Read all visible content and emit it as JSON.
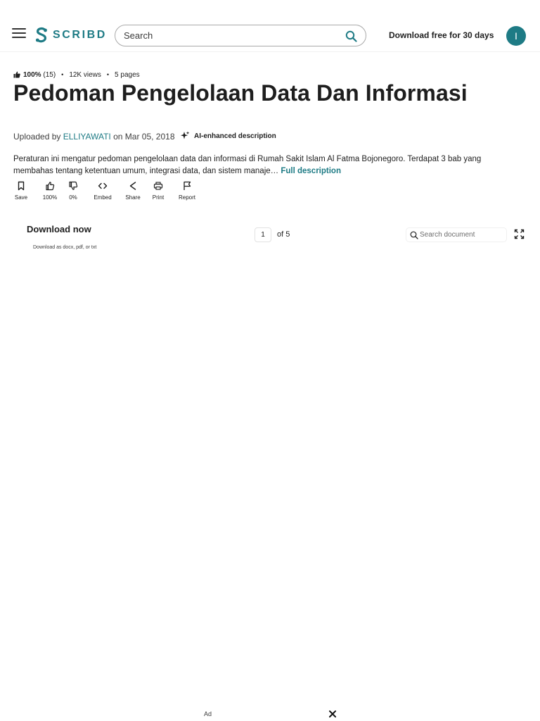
{
  "header": {
    "logo_text": "SCRIBD",
    "search_placeholder": "Search",
    "download_free_label": "Download free for 30 days",
    "avatar_initial": "I",
    "brand_color": "#1e7b85"
  },
  "meta": {
    "rating": "100%",
    "rating_count": "(15)",
    "views": "12K views",
    "pages": "5 pages"
  },
  "document": {
    "title": "Pedoman Pengelolaan Data Dan Informasi",
    "uploaded_prefix": "Uploaded by",
    "author": "ELLIYAWATI",
    "upload_date": "on Mar 05, 2018",
    "ai_label": "AI-enhanced description",
    "description": "Peraturan ini mengatur pedoman pengelolaan data dan informasi di Rumah Sakit Islam Al Fatma Bojonegoro. Terdapat 3 bab yang membahas tentang ketentuan umum, integrasi data, dan sistem manaje…",
    "full_description_link": "Full description"
  },
  "actions": [
    {
      "label": "Save",
      "icon": "bookmark-icon"
    },
    {
      "label": "100%",
      "icon": "thumbs-up-icon"
    },
    {
      "label": "0%",
      "icon": "thumbs-down-icon"
    },
    {
      "label": "Embed",
      "icon": "code-icon"
    },
    {
      "label": "Share",
      "icon": "share-icon"
    },
    {
      "label": "Print",
      "icon": "print-icon"
    },
    {
      "label": "Report",
      "icon": "flag-icon"
    }
  ],
  "viewer": {
    "download_now": "Download now",
    "download_formats": "Download as docx, pdf, or txt",
    "current_page": "1",
    "page_total": "of 5",
    "search_placeholder": "Search document"
  },
  "ad": {
    "label": "Ad"
  }
}
